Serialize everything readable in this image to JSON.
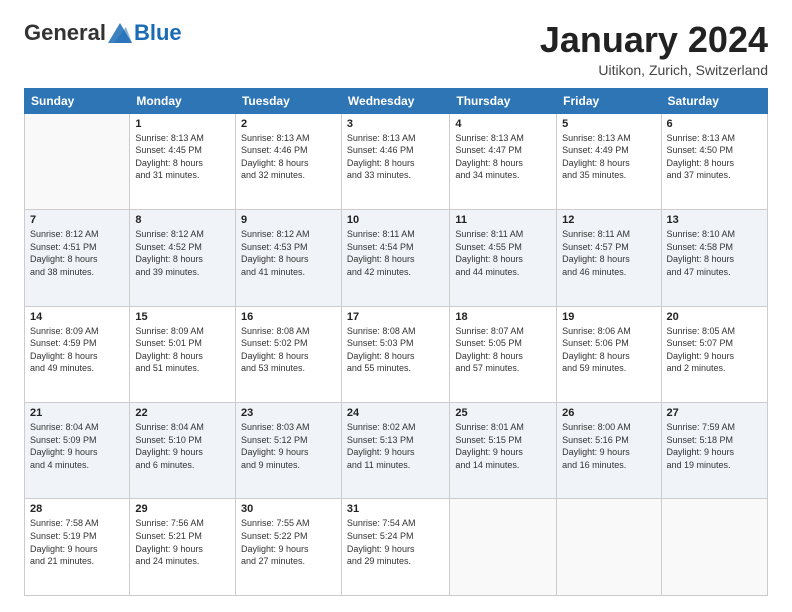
{
  "header": {
    "logo": {
      "general": "General",
      "blue": "Blue"
    },
    "title": "January 2024",
    "subtitle": "Uitikon, Zurich, Switzerland"
  },
  "calendar": {
    "days_of_week": [
      "Sunday",
      "Monday",
      "Tuesday",
      "Wednesday",
      "Thursday",
      "Friday",
      "Saturday"
    ],
    "weeks": [
      [
        {
          "day": "",
          "info": ""
        },
        {
          "day": "1",
          "info": "Sunrise: 8:13 AM\nSunset: 4:45 PM\nDaylight: 8 hours\nand 31 minutes."
        },
        {
          "day": "2",
          "info": "Sunrise: 8:13 AM\nSunset: 4:46 PM\nDaylight: 8 hours\nand 32 minutes."
        },
        {
          "day": "3",
          "info": "Sunrise: 8:13 AM\nSunset: 4:46 PM\nDaylight: 8 hours\nand 33 minutes."
        },
        {
          "day": "4",
          "info": "Sunrise: 8:13 AM\nSunset: 4:47 PM\nDaylight: 8 hours\nand 34 minutes."
        },
        {
          "day": "5",
          "info": "Sunrise: 8:13 AM\nSunset: 4:49 PM\nDaylight: 8 hours\nand 35 minutes."
        },
        {
          "day": "6",
          "info": "Sunrise: 8:13 AM\nSunset: 4:50 PM\nDaylight: 8 hours\nand 37 minutes."
        }
      ],
      [
        {
          "day": "7",
          "info": "Sunrise: 8:12 AM\nSunset: 4:51 PM\nDaylight: 8 hours\nand 38 minutes."
        },
        {
          "day": "8",
          "info": "Sunrise: 8:12 AM\nSunset: 4:52 PM\nDaylight: 8 hours\nand 39 minutes."
        },
        {
          "day": "9",
          "info": "Sunrise: 8:12 AM\nSunset: 4:53 PM\nDaylight: 8 hours\nand 41 minutes."
        },
        {
          "day": "10",
          "info": "Sunrise: 8:11 AM\nSunset: 4:54 PM\nDaylight: 8 hours\nand 42 minutes."
        },
        {
          "day": "11",
          "info": "Sunrise: 8:11 AM\nSunset: 4:55 PM\nDaylight: 8 hours\nand 44 minutes."
        },
        {
          "day": "12",
          "info": "Sunrise: 8:11 AM\nSunset: 4:57 PM\nDaylight: 8 hours\nand 46 minutes."
        },
        {
          "day": "13",
          "info": "Sunrise: 8:10 AM\nSunset: 4:58 PM\nDaylight: 8 hours\nand 47 minutes."
        }
      ],
      [
        {
          "day": "14",
          "info": "Sunrise: 8:09 AM\nSunset: 4:59 PM\nDaylight: 8 hours\nand 49 minutes."
        },
        {
          "day": "15",
          "info": "Sunrise: 8:09 AM\nSunset: 5:01 PM\nDaylight: 8 hours\nand 51 minutes."
        },
        {
          "day": "16",
          "info": "Sunrise: 8:08 AM\nSunset: 5:02 PM\nDaylight: 8 hours\nand 53 minutes."
        },
        {
          "day": "17",
          "info": "Sunrise: 8:08 AM\nSunset: 5:03 PM\nDaylight: 8 hours\nand 55 minutes."
        },
        {
          "day": "18",
          "info": "Sunrise: 8:07 AM\nSunset: 5:05 PM\nDaylight: 8 hours\nand 57 minutes."
        },
        {
          "day": "19",
          "info": "Sunrise: 8:06 AM\nSunset: 5:06 PM\nDaylight: 8 hours\nand 59 minutes."
        },
        {
          "day": "20",
          "info": "Sunrise: 8:05 AM\nSunset: 5:07 PM\nDaylight: 9 hours\nand 2 minutes."
        }
      ],
      [
        {
          "day": "21",
          "info": "Sunrise: 8:04 AM\nSunset: 5:09 PM\nDaylight: 9 hours\nand 4 minutes."
        },
        {
          "day": "22",
          "info": "Sunrise: 8:04 AM\nSunset: 5:10 PM\nDaylight: 9 hours\nand 6 minutes."
        },
        {
          "day": "23",
          "info": "Sunrise: 8:03 AM\nSunset: 5:12 PM\nDaylight: 9 hours\nand 9 minutes."
        },
        {
          "day": "24",
          "info": "Sunrise: 8:02 AM\nSunset: 5:13 PM\nDaylight: 9 hours\nand 11 minutes."
        },
        {
          "day": "25",
          "info": "Sunrise: 8:01 AM\nSunset: 5:15 PM\nDaylight: 9 hours\nand 14 minutes."
        },
        {
          "day": "26",
          "info": "Sunrise: 8:00 AM\nSunset: 5:16 PM\nDaylight: 9 hours\nand 16 minutes."
        },
        {
          "day": "27",
          "info": "Sunrise: 7:59 AM\nSunset: 5:18 PM\nDaylight: 9 hours\nand 19 minutes."
        }
      ],
      [
        {
          "day": "28",
          "info": "Sunrise: 7:58 AM\nSunset: 5:19 PM\nDaylight: 9 hours\nand 21 minutes."
        },
        {
          "day": "29",
          "info": "Sunrise: 7:56 AM\nSunset: 5:21 PM\nDaylight: 9 hours\nand 24 minutes."
        },
        {
          "day": "30",
          "info": "Sunrise: 7:55 AM\nSunset: 5:22 PM\nDaylight: 9 hours\nand 27 minutes."
        },
        {
          "day": "31",
          "info": "Sunrise: 7:54 AM\nSunset: 5:24 PM\nDaylight: 9 hours\nand 29 minutes."
        },
        {
          "day": "",
          "info": ""
        },
        {
          "day": "",
          "info": ""
        },
        {
          "day": "",
          "info": ""
        }
      ]
    ]
  }
}
